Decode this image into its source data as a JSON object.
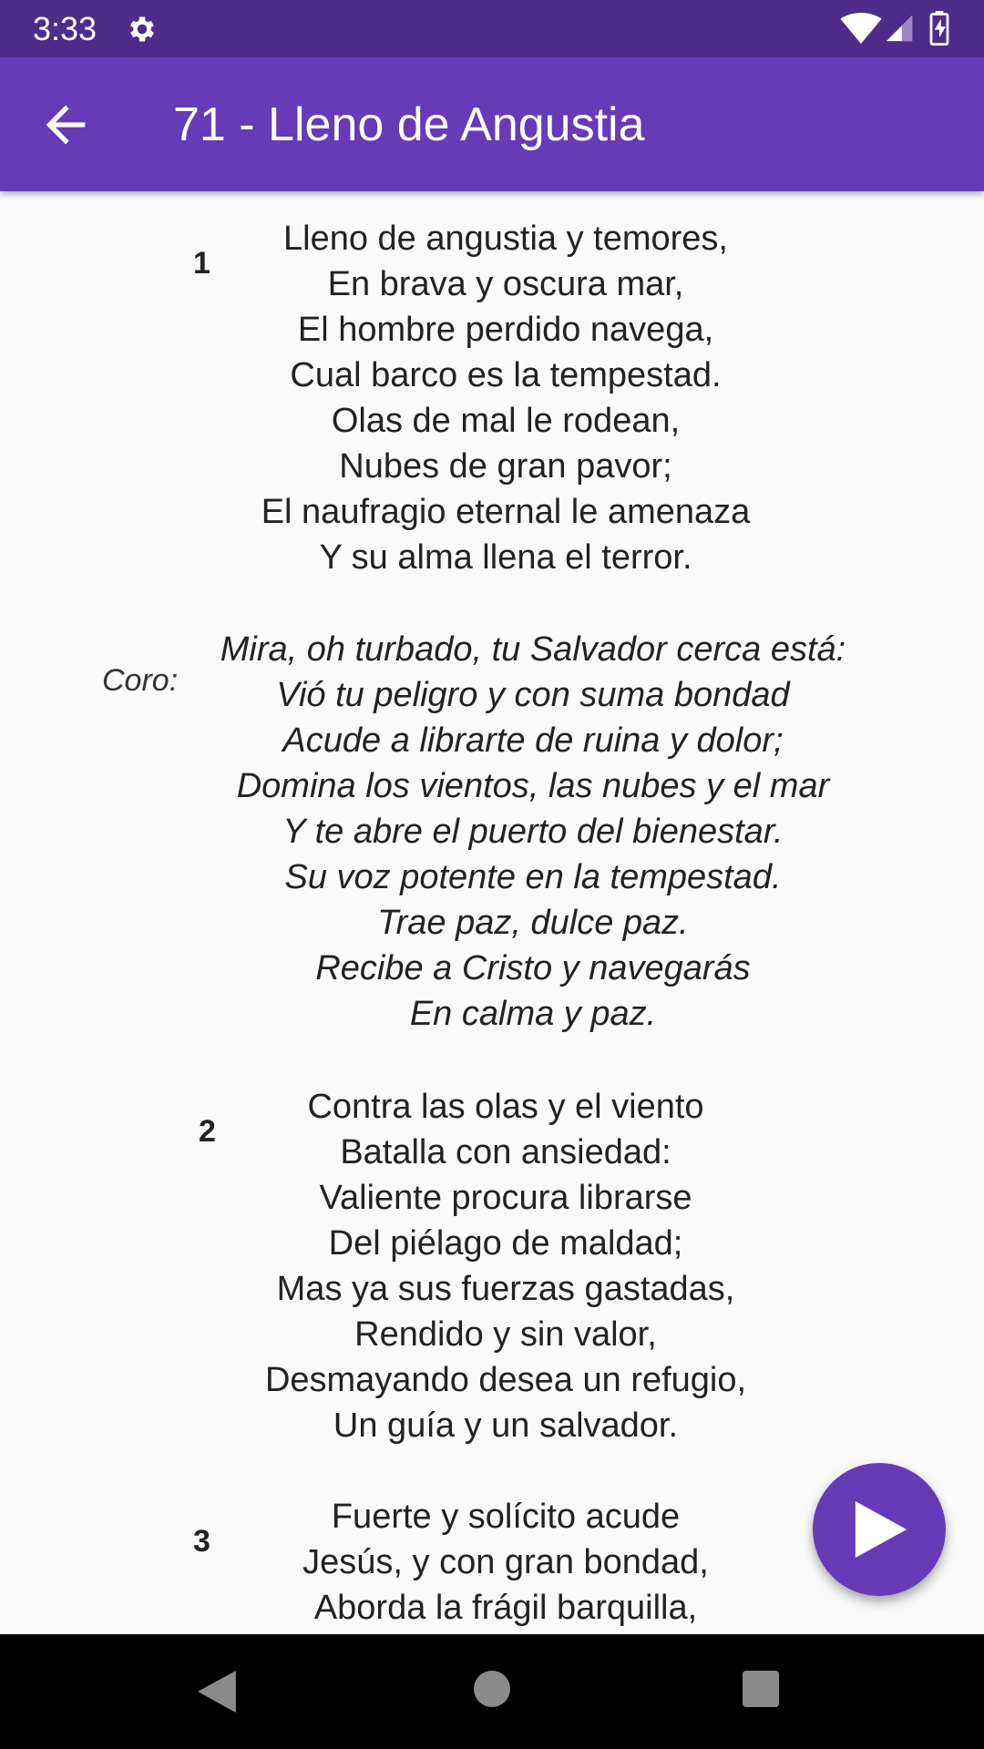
{
  "status_bar": {
    "time": "3:33",
    "icons": [
      "gear-icon",
      "wifi-icon",
      "signal-icon",
      "battery-icon"
    ]
  },
  "app_bar": {
    "title": "71 - Lleno de Angustia",
    "back_icon": "arrow-left-icon"
  },
  "colors": {
    "primary": "#673ab7",
    "status_bar": "#4f2c8a",
    "background": "#fafafa"
  },
  "hymn": {
    "verse1": {
      "number": "1",
      "lines": [
        "Lleno de angustia y temores,",
        "En brava y oscura mar,",
        "El hombre perdido navega,",
        "Cual barco es la tempestad.",
        "Olas de mal le rodean,",
        "Nubes de gran pavor;",
        "El naufragio eternal le amenaza",
        "Y su alma llena el terror."
      ]
    },
    "chorus": {
      "label": "Coro:",
      "lines": [
        "Mira, oh turbado, tu Salvador cerca está:",
        "Vió tu peligro y con suma bondad",
        "Acude a librarte de ruina y dolor;",
        "Domina los vientos, las nubes y el mar",
        "Y te abre el puerto del bienestar.",
        "Su voz potente en la tempestad.",
        "Trae paz, dulce paz.",
        "Recibe a Cristo y navegarás",
        "En calma y paz."
      ]
    },
    "verse2": {
      "number": "2",
      "lines": [
        "Contra las olas y el viento",
        "Batalla con ansiedad:",
        "Valiente procura librarse",
        "Del piélago de maldad;",
        "Mas ya sus fuerzas gastadas,",
        "Rendido y sin valor,",
        "Desmayando desea un refugio,",
        "Un guía y un salvador."
      ]
    },
    "verse3": {
      "number": "3",
      "lines": [
        "Fuerte y solícito acude",
        "Jesús, y con gran bondad,",
        "Aborda la frágil barquilla,"
      ]
    }
  },
  "fab": {
    "icon": "play-icon"
  },
  "nav_bar": {
    "icons": [
      "nav-back-icon",
      "nav-home-icon",
      "nav-recent-icon"
    ]
  }
}
